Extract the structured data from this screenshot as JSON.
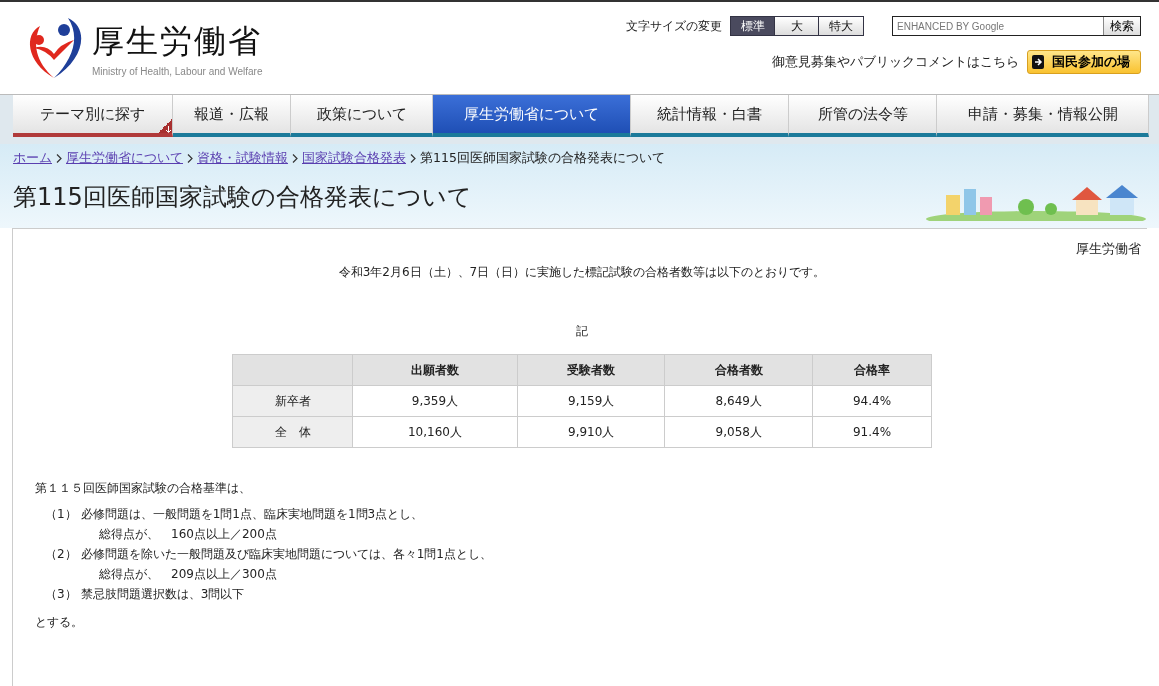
{
  "header": {
    "logo_text": "厚生労働省",
    "logo_subtitle": "Ministry of Health, Labour and Welfare",
    "font_size_label": "文字サイズの変更",
    "font_sizes": [
      {
        "label": "標準",
        "selected": true
      },
      {
        "label": "大",
        "selected": false
      },
      {
        "label": "特大",
        "selected": false
      }
    ],
    "search": {
      "placeholder": "ENHANCED BY Google",
      "button": "検索"
    },
    "participation_text": "御意見募集やパブリックコメントはこちら",
    "participation_button": "国民参加の場"
  },
  "nav": [
    {
      "label": "テーマ別に探す",
      "selected": false,
      "kind": "menu"
    },
    {
      "label": "報道・広報",
      "selected": false,
      "kind": "link"
    },
    {
      "label": "政策について",
      "selected": false,
      "kind": "link"
    },
    {
      "label": "厚生労働省について",
      "selected": true,
      "kind": "link"
    },
    {
      "label": "統計情報・白書",
      "selected": false,
      "kind": "link"
    },
    {
      "label": "所管の法令等",
      "selected": false,
      "kind": "link"
    },
    {
      "label": "申請・募集・情報公開",
      "selected": false,
      "kind": "link"
    }
  ],
  "breadcrumb": {
    "links": [
      "ホーム",
      "厚生労働省について",
      "資格・試験情報",
      "国家試験合格発表"
    ],
    "current": "第115回医師国家試験の合格発表について"
  },
  "page_title": "第115回医師国家試験の合格発表について",
  "content": {
    "author": "厚生労働省",
    "intro": "令和3年2月6日（土）、7日（日）に実施した標記試験の合格者数等は以下のとおりです。",
    "note_heading": "記",
    "table": {
      "columns": [
        "出願者数",
        "受験者数",
        "合格者数",
        "合格率"
      ],
      "rows": [
        {
          "label": "新卒者",
          "cells": [
            "9,359人",
            "9,159人",
            "8,649人",
            "94.4%"
          ]
        },
        {
          "label": "全　体",
          "cells": [
            "10,160人",
            "9,910人",
            "9,058人",
            "91.4%"
          ]
        }
      ]
    },
    "criteria": {
      "heading": "第１１５回医師国家試験の合格基準は、",
      "items": [
        {
          "number": "（1）",
          "text": "必修問題は、一般問題を1問1点、臨床実地問題を1問3点とし、",
          "detail": "総得点が、　160点以上／200点"
        },
        {
          "number": "（2）",
          "text": "必修問題を除いた一般問題及び臨床実地問題については、各々1問1点とし、",
          "detail": "総得点が、　209点以上／300点"
        },
        {
          "number": "（3）",
          "text": "禁忌肢問題選択数は、3問以下"
        }
      ],
      "closing": "とする。"
    }
  }
}
